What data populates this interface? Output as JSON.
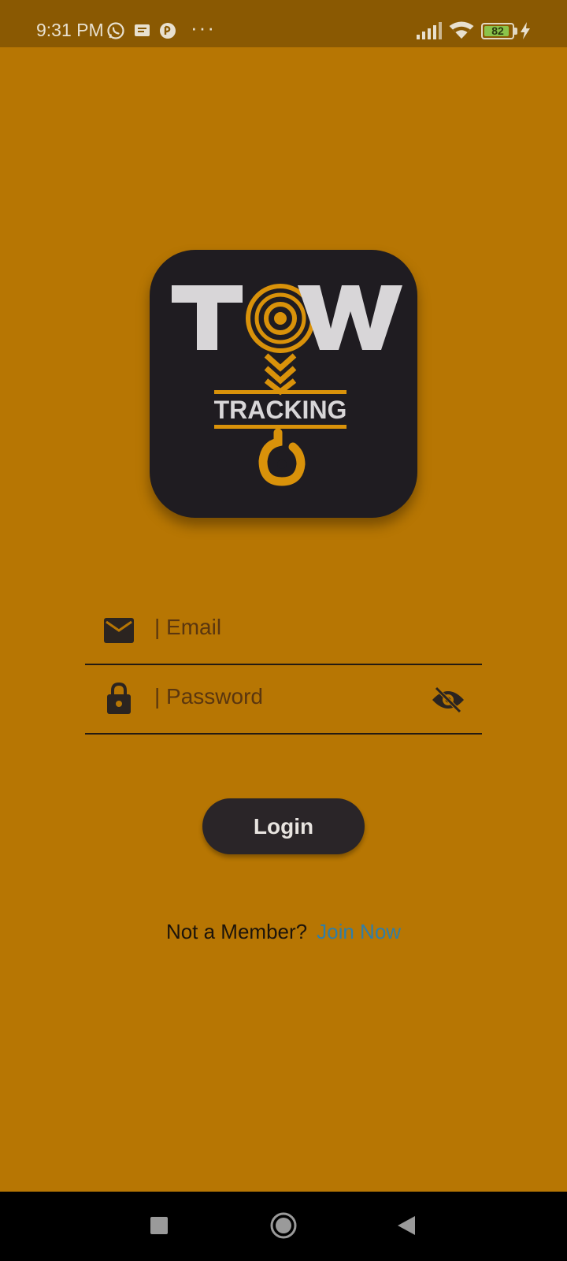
{
  "status_bar": {
    "time": "9:31 PM",
    "dots": "···",
    "battery_level": "82",
    "icons": [
      "whatsapp-icon",
      "message-icon",
      "app-icon",
      "signal-icon",
      "wifi-icon",
      "battery-icon",
      "charging-icon"
    ]
  },
  "logo": {
    "word_top": "TOW",
    "word_bottom": "TRACKING"
  },
  "form": {
    "email_placeholder": "| Email",
    "password_placeholder": "| Password",
    "login_label": "Login"
  },
  "signup": {
    "prompt": "Not a Member?",
    "link": "Join Now"
  },
  "colors": {
    "background": "#B77603",
    "status_bar": "#8A5902",
    "accent": "#D9920A",
    "button": "#2A2528",
    "link": "#2F7EA9"
  },
  "nav": {
    "buttons": [
      "recent-apps",
      "home",
      "back"
    ]
  }
}
